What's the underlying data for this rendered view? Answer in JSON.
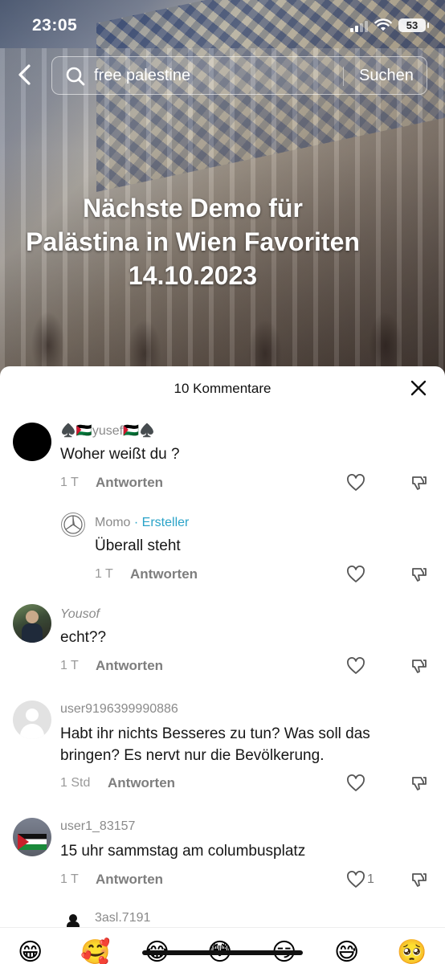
{
  "status_bar": {
    "time": "23:05",
    "battery": "53"
  },
  "search": {
    "query": "free palestine",
    "button_label": "Suchen"
  },
  "video": {
    "caption_lines": [
      "Nächste Demo für",
      "Palästina in Wien Favoriten",
      "14.10.2023"
    ]
  },
  "comments_panel": {
    "title": "10 Kommentare",
    "reply_label": "Antworten",
    "comments": [
      {
        "username": "♠️🇵🇸yusef🇵🇸♠️",
        "text": "Woher weißt du ?",
        "time": "1 T"
      },
      {
        "username": "Momo",
        "creator_badge": "· Ersteller",
        "text": "Überall steht",
        "time": "1 T"
      },
      {
        "username": "Yousof",
        "text": "echt??",
        "time": "1 T"
      },
      {
        "username": "user9196399990886",
        "text": "Habt ihr nichts Besseres zu tun? Was soll das bringen? Es nervt nur die Bevölkerung.",
        "time": "1 Std"
      },
      {
        "username": "user1_83157",
        "text": "15 uhr sammstag am columbusplatz",
        "time": "1 T",
        "likes": "1"
      },
      {
        "username": "3asl.7191"
      }
    ]
  },
  "emoji_bar": [
    "😁",
    "🥰",
    "😂",
    "😳",
    "😏",
    "😅",
    "🥺"
  ],
  "colors": {
    "creator_accent": "#2aa3c8",
    "sheet_bg": "#ffffff",
    "muted_text": "#9a9a9a"
  }
}
